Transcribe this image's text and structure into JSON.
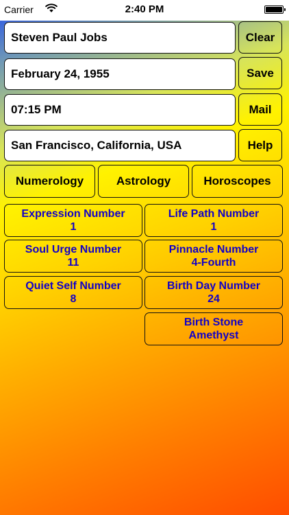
{
  "status_bar": {
    "carrier": "Carrier",
    "time": "2:40 PM",
    "battery_level": 1.0
  },
  "form": {
    "name": "Steven Paul Jobs",
    "date": "February 24, 1955",
    "time": "07:15 PM",
    "location": "San Francisco, California, USA"
  },
  "actions": {
    "clear": "Clear",
    "save": "Save",
    "mail": "Mail",
    "help": "Help"
  },
  "tabs": [
    "Numerology",
    "Astrology",
    "Horoscopes"
  ],
  "results": [
    {
      "title": "Expression Number",
      "value": "1"
    },
    {
      "title": "Life Path Number",
      "value": "1"
    },
    {
      "title": "Soul Urge Number",
      "value": "11"
    },
    {
      "title": "Pinnacle Number",
      "value": "4-Fourth"
    },
    {
      "title": "Quiet Self Number",
      "value": "8"
    },
    {
      "title": "Birth Day Number",
      "value": "24"
    },
    {
      "title": "Birth Stone",
      "value": "Amethyst"
    }
  ],
  "colors": {
    "result_text": "#1200c8",
    "gradient_top": "#1f4cf0",
    "gradient_mid": "#fff200",
    "gradient_bottom": "#ff4d00"
  },
  "icons": {
    "wifi": "wifi-icon",
    "battery": "battery-icon"
  }
}
